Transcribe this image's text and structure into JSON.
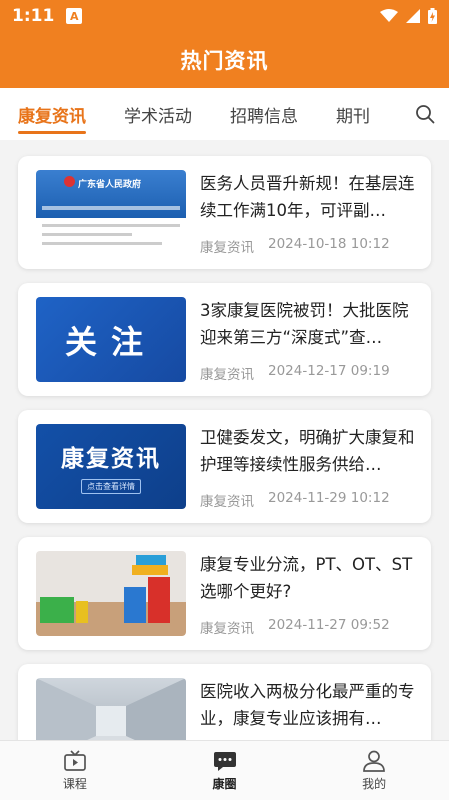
{
  "status": {
    "time": "1:11",
    "notification_icon": "A"
  },
  "header": {
    "title": "热门资讯"
  },
  "tabs": [
    {
      "label": "康复资讯",
      "active": true
    },
    {
      "label": "学术活动",
      "active": false
    },
    {
      "label": "招聘信息",
      "active": false
    },
    {
      "label": "期刊",
      "active": false
    }
  ],
  "articles": [
    {
      "title": "医务人员晋升新规！在基层连续工作满10年，可评副…",
      "category": "康复资讯",
      "date": "2024-10-18 10:12",
      "thumb": {
        "kind": "gov-site",
        "caption": "广东省人民政府"
      }
    },
    {
      "title": "3家康复医院被罚！大批医院迎来第三方“深度式”查…",
      "category": "康复资讯",
      "date": "2024-12-17 09:19",
      "thumb": {
        "kind": "banner",
        "caption": "关注"
      }
    },
    {
      "title": "卫健委发文，明确扩大康复和护理等接续性服务供给…",
      "category": "康复资讯",
      "date": "2024-11-29 10:12",
      "thumb": {
        "kind": "banner",
        "caption": "康复资讯",
        "sub": "点击查看详情"
      }
    },
    {
      "title": "康复专业分流，PT、OT、ST选哪个更好?",
      "category": "康复资讯",
      "date": "2024-11-27 09:52",
      "thumb": {
        "kind": "photo-blocks"
      }
    },
    {
      "title": "医院收入两极分化最严重的专业，康复专业应该拥有…",
      "category": "",
      "date": "",
      "thumb": {
        "kind": "photo-hallway"
      }
    }
  ],
  "bottom_nav": [
    {
      "label": "课程",
      "icon": "tv-icon",
      "active": false
    },
    {
      "label": "康圈",
      "icon": "chat-icon",
      "active": true
    },
    {
      "label": "我的",
      "icon": "person-icon",
      "active": false
    }
  ],
  "colors": {
    "brand": "#f08020",
    "tab_active": "#e8741a"
  }
}
